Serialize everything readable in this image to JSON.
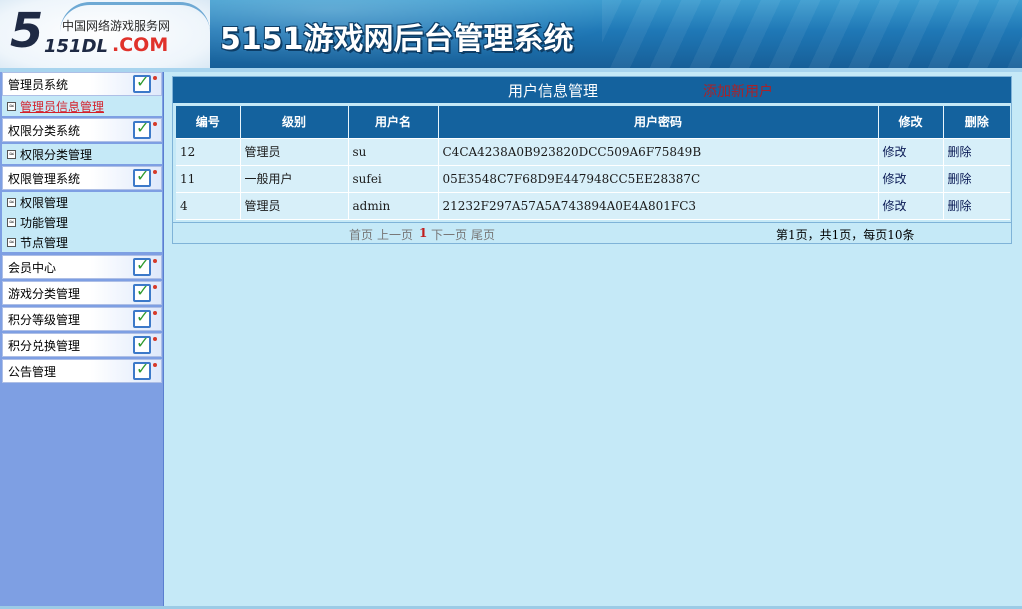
{
  "header": {
    "logo_five": "5",
    "logo_tagline": "中国网络游戏服务网",
    "logo_151dl": "151DL",
    "logo_com": ".COM",
    "app_title": "5151游戏网后台管理系统"
  },
  "sidebar": {
    "sections": [
      {
        "label": "管理员系统",
        "items": [
          {
            "label": "管理员信息管理",
            "active": true
          }
        ]
      },
      {
        "label": "权限分类系统",
        "items": [
          {
            "label": "权限分类管理"
          }
        ]
      },
      {
        "label": "权限管理系统",
        "items": [
          {
            "label": "权限管理"
          },
          {
            "label": "功能管理"
          },
          {
            "label": "节点管理"
          }
        ]
      },
      {
        "label": "会员中心",
        "items": []
      },
      {
        "label": "游戏分类管理",
        "items": []
      },
      {
        "label": "积分等级管理",
        "items": []
      },
      {
        "label": "积分兑换管理",
        "items": []
      },
      {
        "label": "公告管理",
        "items": []
      }
    ]
  },
  "main": {
    "title": "用户信息管理",
    "add_user": "添加新用户",
    "columns": [
      "编号",
      "级别",
      "用户名",
      "用户密码",
      "修改",
      "删除"
    ],
    "rows": [
      {
        "id": "12",
        "level": "管理员",
        "username": "su",
        "password": "C4CA4238A0B923820DCC509A6F75849B",
        "edit": "修改",
        "delete": "删除"
      },
      {
        "id": "11",
        "level": "一般用户",
        "username": "sufei",
        "password": "05E3548C7F68D9E447948CC5EE28387C",
        "edit": "修改",
        "delete": "删除"
      },
      {
        "id": "4",
        "level": "管理员",
        "username": "admin",
        "password": "21232F297A57A5A743894A0E4A801FC3",
        "edit": "修改",
        "delete": "删除"
      }
    ],
    "pager": {
      "first": "首页",
      "prev": "上一页",
      "current": "1",
      "next": "下一页",
      "last": "尾页",
      "summary": "第1页，共1页，每页10条"
    }
  },
  "colors": {
    "header_blue": "#1f78b6",
    "sidebar_bg": "#7e9fe3",
    "content_bg": "#c5e9f7",
    "table_header": "#14629e",
    "active_link": "#d4202a"
  }
}
